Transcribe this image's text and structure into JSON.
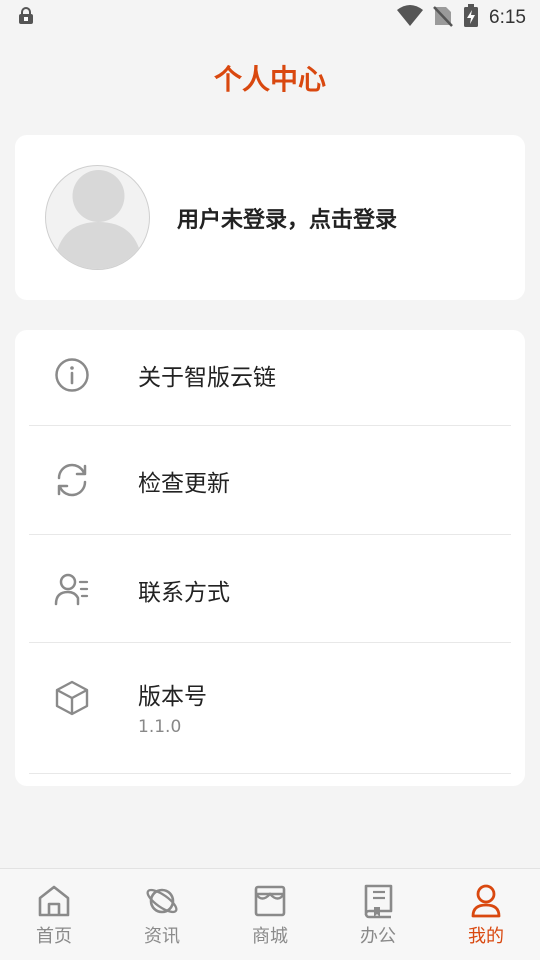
{
  "status_bar": {
    "time": "6:15",
    "icons": [
      "lock-icon",
      "wifi-icon",
      "no-sim-icon",
      "battery-charging-icon"
    ]
  },
  "page": {
    "title": "个人中心"
  },
  "profile": {
    "login_prompt": "用户未登录，点击登录",
    "avatar_icon": "default-avatar-icon"
  },
  "menu": {
    "items": [
      {
        "label": "关于智版云链",
        "icon": "info-icon"
      },
      {
        "label": "检查更新",
        "icon": "refresh-icon"
      },
      {
        "label": "联系方式",
        "icon": "contact-icon"
      },
      {
        "label": "版本号",
        "sub": "1.1.0",
        "icon": "box-icon"
      }
    ]
  },
  "tabs": [
    {
      "label": "首页",
      "icon": "home-icon",
      "active": false
    },
    {
      "label": "资讯",
      "icon": "planet-icon",
      "active": false
    },
    {
      "label": "商城",
      "icon": "store-icon",
      "active": false
    },
    {
      "label": "办公",
      "icon": "book-icon",
      "active": false
    },
    {
      "label": "我的",
      "icon": "user-icon",
      "active": true
    }
  ],
  "colors": {
    "accent": "#d9480f",
    "background": "#f4f4f4",
    "card": "#ffffff",
    "inactive_tab": "#8a8a8a",
    "icon_gray": "#8a8a8a"
  }
}
